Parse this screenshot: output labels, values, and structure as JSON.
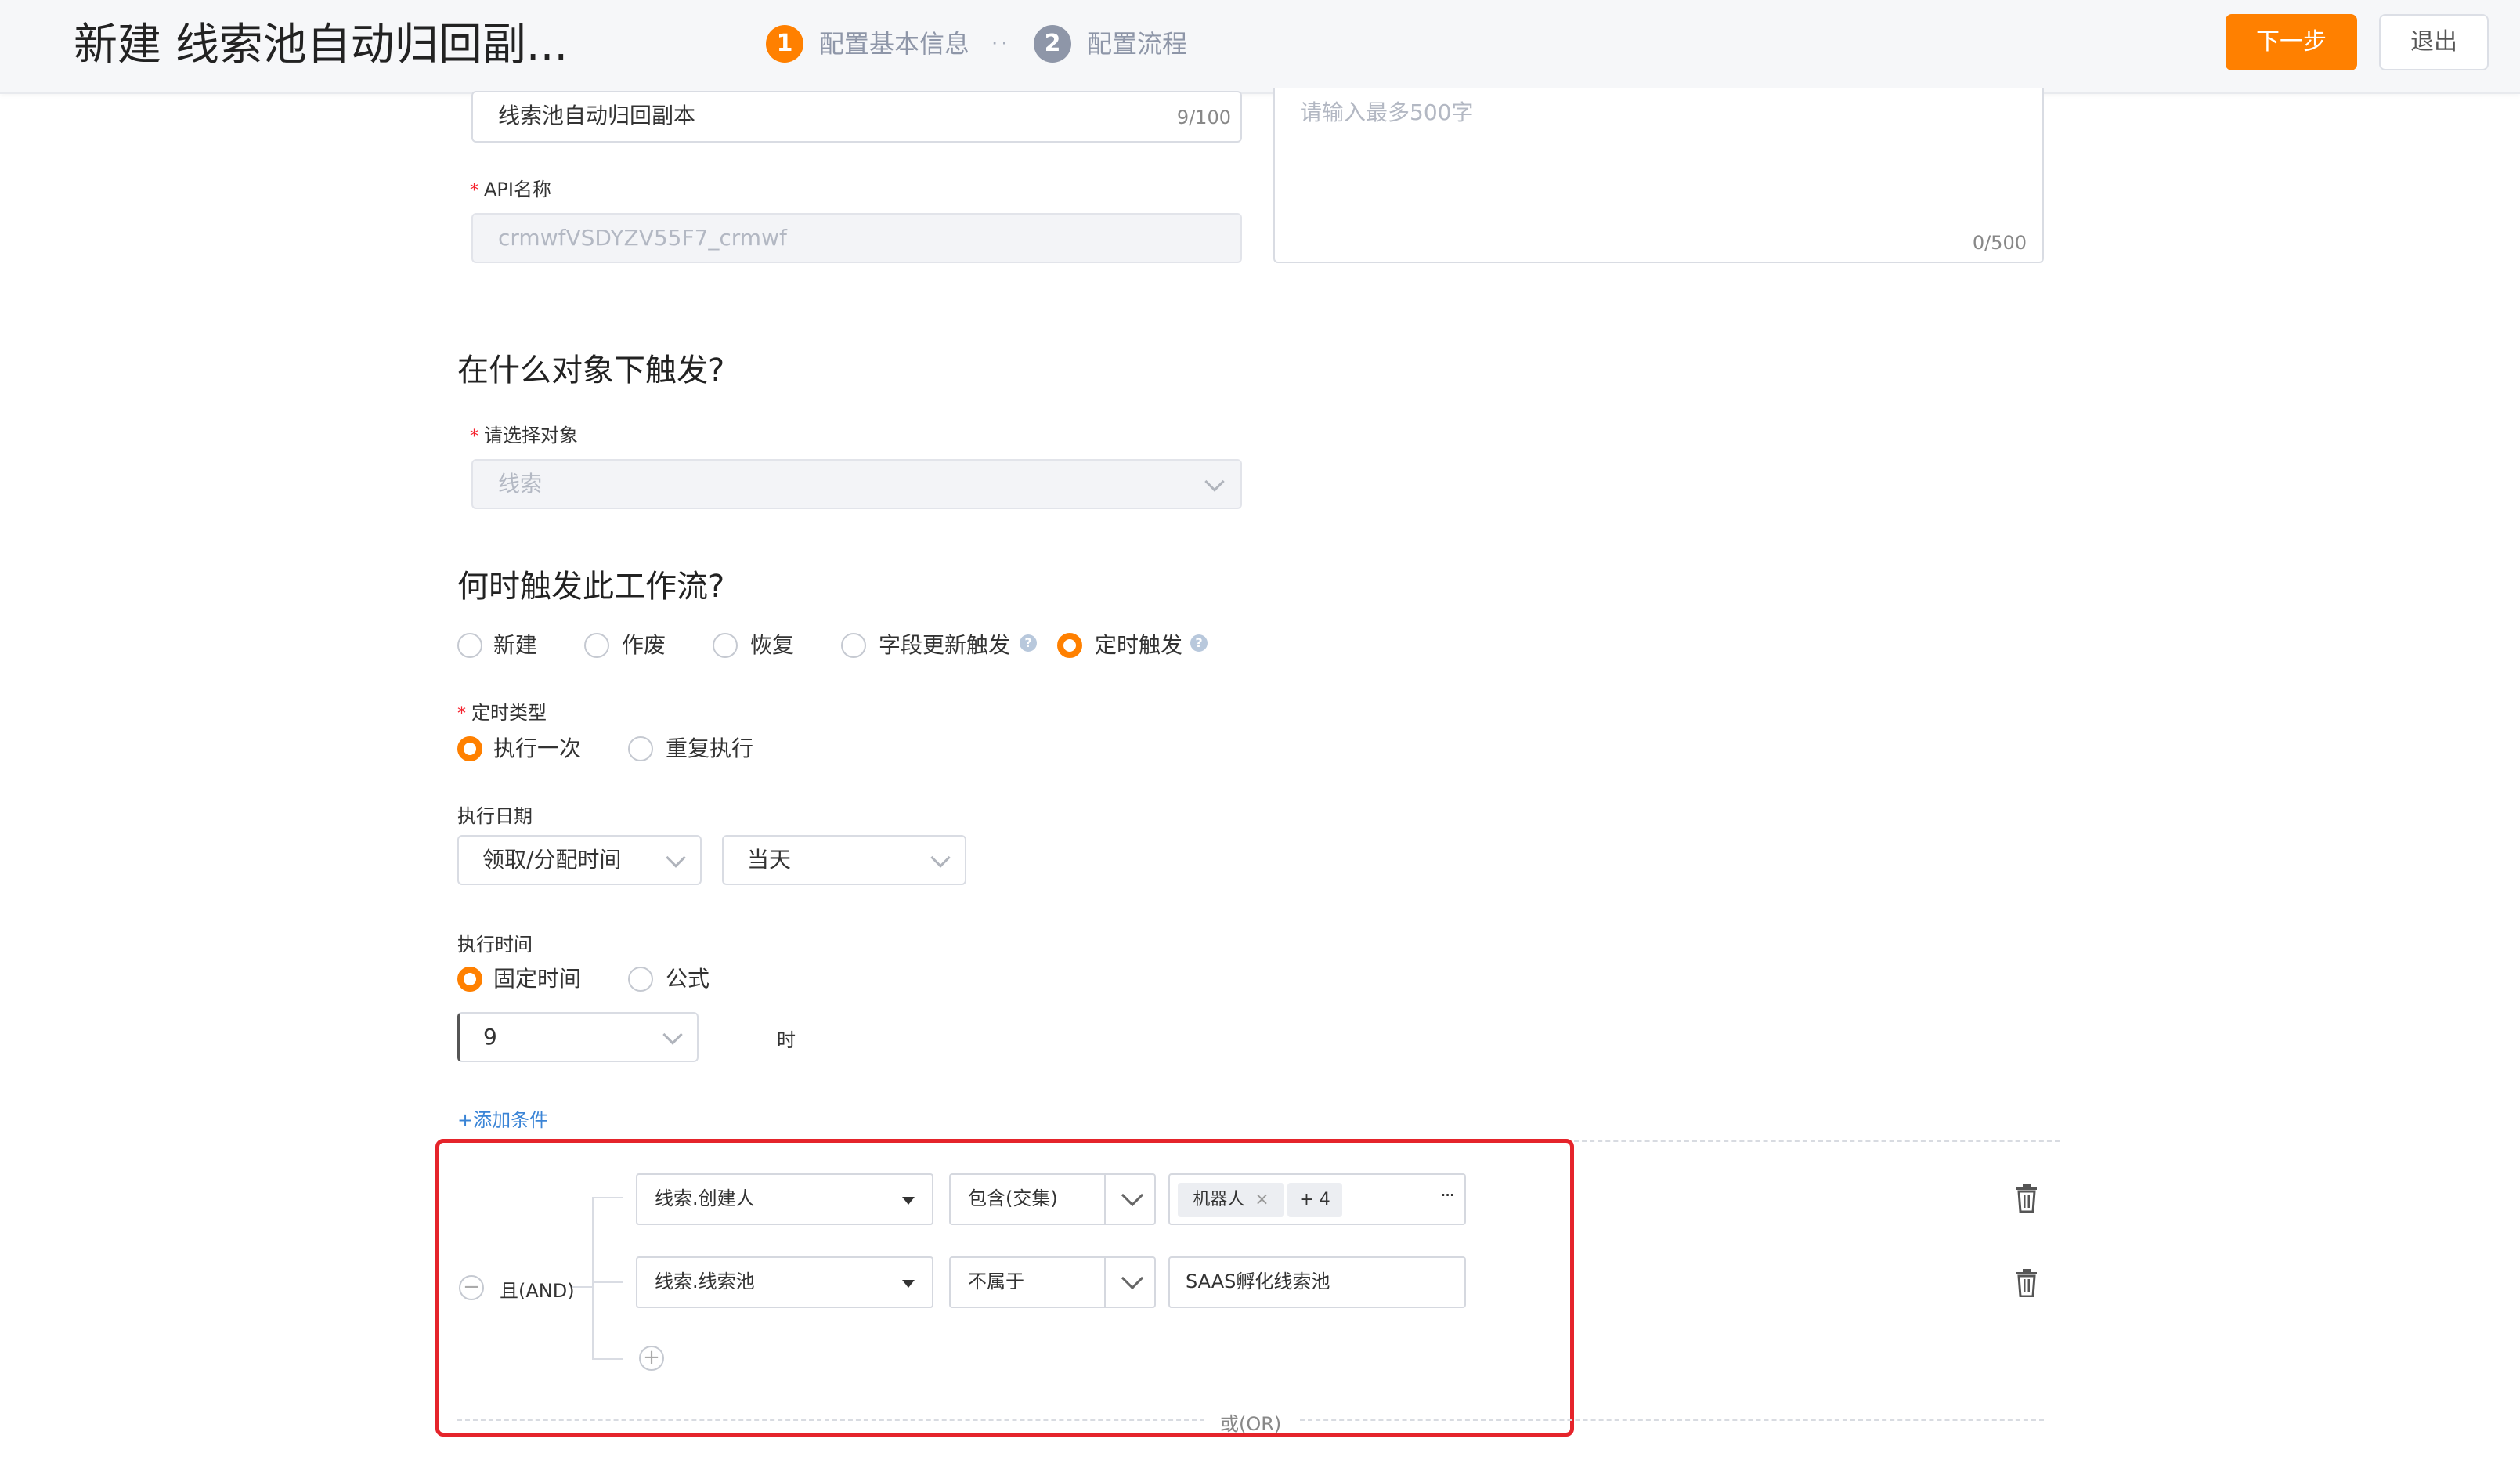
{
  "header": {
    "title": "新建 线索池自动归回副...",
    "steps": [
      {
        "num": "1",
        "label": "配置基本信息",
        "color": "#ff8000"
      },
      {
        "num": "2",
        "label": "配置流程",
        "color": "#8e96a8"
      }
    ],
    "steps_separator": "··",
    "next_button": "下一步",
    "exit_button": "退出"
  },
  "basic": {
    "name_value": "线索池自动归回副本",
    "name_counter": "9/100",
    "api_label": "API名称",
    "api_value": "crmwfVSDYZV55F7_crmwf",
    "desc_placeholder": "请输入最多500字",
    "desc_counter": "0/500"
  },
  "object": {
    "section_title": "在什么对象下触发?",
    "select_label": "请选择对象",
    "select_value": "线索"
  },
  "trigger": {
    "section_title": "何时触发此工作流?",
    "options": [
      "新建",
      "作废",
      "恢复",
      "字段更新触发",
      "定时触发"
    ],
    "selected": "定时触发",
    "timer_type_label": "定时类型",
    "timer_types": [
      "执行一次",
      "重复执行"
    ],
    "timer_type_selected": "执行一次",
    "exec_date_label": "执行日期",
    "exec_date_field": "领取/分配时间",
    "exec_date_offset": "当天",
    "exec_time_label": "执行时间",
    "exec_time_modes": [
      "固定时间",
      "公式"
    ],
    "exec_time_selected": "固定时间",
    "hour_value": "9",
    "hour_unit": "时",
    "add_condition": "+添加条件"
  },
  "conditions": {
    "group_label": "且(AND)",
    "or_label": "或(OR)",
    "rows": [
      {
        "field": "线索.创建人",
        "operator": "包含(交集)",
        "tag": "机器人",
        "more": "+ 4",
        "ellipsis": "···"
      },
      {
        "field": "线索.线索池",
        "operator": "不属于",
        "value": "SAAS孵化线索池"
      }
    ]
  },
  "colors": {
    "accent": "#ff8000",
    "highlight_border": "#e5242b",
    "link": "#3a84d6"
  }
}
